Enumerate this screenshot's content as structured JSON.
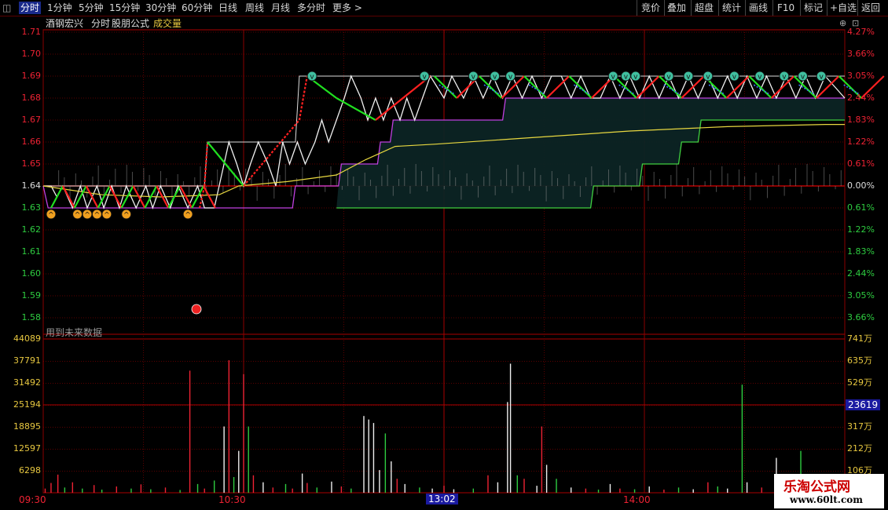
{
  "toolbar": {
    "tabs": [
      "分时",
      "1分钟",
      "5分钟",
      "15分钟",
      "30分钟",
      "60分钟",
      "日线",
      "周线",
      "月线",
      "多分时",
      "更多 >"
    ],
    "right_buttons": [
      "竞价",
      "叠加",
      "超盘",
      "统计",
      "画线",
      "F10",
      "标记",
      "+自选",
      "返回"
    ]
  },
  "header": {
    "stock_name": "酒钢宏兴",
    "mode": "分时",
    "formula": "股朋公式",
    "volume_label": "成交量"
  },
  "price_axis": {
    "left": [
      "1.71",
      "1.70",
      "1.69",
      "1.68",
      "1.67",
      "1.66",
      "1.65",
      "1.64",
      "1.63",
      "1.62",
      "1.61",
      "1.60",
      "1.59",
      "1.58"
    ],
    "right": [
      "4.27%",
      "3.66%",
      "3.05%",
      "2.44%",
      "1.83%",
      "1.22%",
      "0.61%",
      "0.00%",
      "0.61%",
      "1.22%",
      "1.83%",
      "2.44%",
      "3.05%",
      "3.66%"
    ]
  },
  "volume_axis": {
    "left": [
      "44089",
      "37791",
      "31492",
      "25194",
      "18895",
      "12597",
      "6298"
    ],
    "right": [
      "741万",
      "635万",
      "529万",
      "423万",
      "317万",
      "212万",
      "106万"
    ],
    "cursor_value": "23619"
  },
  "time_axis": {
    "labels": [
      "09:30",
      "10:30",
      "14:00"
    ],
    "cursor_time": "13:02"
  },
  "notes": {
    "future_data": "用到未来数据"
  },
  "watermark": {
    "title": "乐淘公式网",
    "url": "www.60lt.com"
  },
  "colors": {
    "up": "#e8202a",
    "down": "#2ecc40",
    "grid": "#7a0000",
    "accent_yellow": "#e8c840"
  },
  "chart_data": {
    "type": "line",
    "price_range": [
      1.58,
      1.71
    ],
    "prev_close": 1.64,
    "price": [
      [
        0,
        1.64
      ],
      [
        8,
        1.64
      ],
      [
        14,
        1.635
      ],
      [
        20,
        1.64
      ],
      [
        30,
        1.63
      ],
      [
        38,
        1.64
      ],
      [
        45,
        1.63
      ],
      [
        55,
        1.64
      ],
      [
        62,
        1.63
      ],
      [
        70,
        1.64
      ],
      [
        78,
        1.63
      ],
      [
        85,
        1.64
      ],
      [
        95,
        1.63
      ],
      [
        105,
        1.64
      ],
      [
        112,
        1.63
      ],
      [
        120,
        1.64
      ],
      [
        130,
        1.63
      ],
      [
        138,
        1.64
      ],
      [
        148,
        1.63
      ],
      [
        158,
        1.64
      ],
      [
        165,
        1.63
      ],
      [
        175,
        1.63
      ],
      [
        180,
        1.64
      ],
      [
        190,
        1.66
      ],
      [
        198,
        1.65
      ],
      [
        205,
        1.64
      ],
      [
        212,
        1.65
      ],
      [
        220,
        1.66
      ],
      [
        230,
        1.65
      ],
      [
        238,
        1.64
      ],
      [
        245,
        1.66
      ],
      [
        252,
        1.65
      ],
      [
        260,
        1.66
      ],
      [
        268,
        1.65
      ],
      [
        278,
        1.66
      ],
      [
        285,
        1.67
      ],
      [
        292,
        1.66
      ],
      [
        300,
        1.67
      ],
      [
        308,
        1.68
      ],
      [
        315,
        1.69
      ],
      [
        325,
        1.68
      ],
      [
        332,
        1.67
      ],
      [
        340,
        1.68
      ],
      [
        348,
        1.67
      ],
      [
        356,
        1.68
      ],
      [
        365,
        1.67
      ],
      [
        372,
        1.68
      ],
      [
        380,
        1.67
      ],
      [
        388,
        1.68
      ],
      [
        396,
        1.69
      ],
      [
        410,
        1.68
      ],
      [
        418,
        1.69
      ],
      [
        430,
        1.68
      ],
      [
        440,
        1.69
      ],
      [
        450,
        1.68
      ],
      [
        460,
        1.69
      ],
      [
        470,
        1.68
      ],
      [
        480,
        1.69
      ],
      [
        490,
        1.68
      ],
      [
        500,
        1.69
      ],
      [
        510,
        1.68
      ],
      [
        520,
        1.69
      ],
      [
        530,
        1.69
      ],
      [
        540,
        1.68
      ],
      [
        550,
        1.69
      ],
      [
        560,
        1.68
      ],
      [
        570,
        1.68
      ],
      [
        580,
        1.69
      ],
      [
        590,
        1.68
      ],
      [
        600,
        1.69
      ],
      [
        610,
        1.68
      ],
      [
        620,
        1.69
      ],
      [
        630,
        1.68
      ],
      [
        640,
        1.69
      ],
      [
        650,
        1.68
      ],
      [
        660,
        1.69
      ],
      [
        670,
        1.68
      ],
      [
        680,
        1.69
      ],
      [
        690,
        1.68
      ],
      [
        700,
        1.69
      ],
      [
        710,
        1.68
      ],
      [
        720,
        1.69
      ],
      [
        730,
        1.68
      ],
      [
        740,
        1.69
      ],
      [
        750,
        1.68
      ],
      [
        760,
        1.69
      ],
      [
        770,
        1.68
      ],
      [
        780,
        1.69
      ],
      [
        790,
        1.68
      ],
      [
        800,
        1.69
      ],
      [
        810,
        1.685
      ],
      [
        820,
        1.68
      ]
    ],
    "avg_price": [
      [
        0,
        1.64
      ],
      [
        60,
        1.636
      ],
      [
        120,
        1.635
      ],
      [
        180,
        1.636
      ],
      [
        200,
        1.64
      ],
      [
        250,
        1.642
      ],
      [
        300,
        1.645
      ],
      [
        330,
        1.652
      ],
      [
        360,
        1.658
      ],
      [
        400,
        1.659
      ],
      [
        500,
        1.662
      ],
      [
        600,
        1.665
      ],
      [
        700,
        1.667
      ],
      [
        800,
        1.668
      ],
      [
        820,
        1.668
      ]
    ],
    "volume_max": 44089,
    "volume": [
      [
        2,
        1200,
        "u"
      ],
      [
        8,
        2800,
        "u"
      ],
      [
        15,
        5200,
        "u"
      ],
      [
        22,
        1500,
        "d"
      ],
      [
        30,
        3000,
        "u"
      ],
      [
        40,
        1200,
        "d"
      ],
      [
        52,
        2200,
        "u"
      ],
      [
        60,
        900,
        "d"
      ],
      [
        75,
        1800,
        "u"
      ],
      [
        90,
        1200,
        "d"
      ],
      [
        100,
        2400,
        "u"
      ],
      [
        110,
        1000,
        "d"
      ],
      [
        125,
        1500,
        "u"
      ],
      [
        140,
        800,
        "d"
      ],
      [
        150,
        35000,
        "u"
      ],
      [
        158,
        2500,
        "d"
      ],
      [
        165,
        1200,
        "u"
      ],
      [
        175,
        3500,
        "d"
      ],
      [
        185,
        19000,
        "w"
      ],
      [
        190,
        38000,
        "u"
      ],
      [
        195,
        4500,
        "d"
      ],
      [
        200,
        12000,
        "w"
      ],
      [
        205,
        34000,
        "u"
      ],
      [
        210,
        19000,
        "d"
      ],
      [
        215,
        5000,
        "u"
      ],
      [
        225,
        3000,
        "w"
      ],
      [
        235,
        1500,
        "u"
      ],
      [
        248,
        2500,
        "d"
      ],
      [
        255,
        1200,
        "u"
      ],
      [
        265,
        5500,
        "w"
      ],
      [
        270,
        2800,
        "u"
      ],
      [
        280,
        1500,
        "d"
      ],
      [
        295,
        3200,
        "w"
      ],
      [
        305,
        1800,
        "u"
      ],
      [
        315,
        1200,
        "d"
      ],
      [
        328,
        22000,
        "w"
      ],
      [
        333,
        21000,
        "w"
      ],
      [
        338,
        20000,
        "w"
      ],
      [
        344,
        6500,
        "w"
      ],
      [
        350,
        17000,
        "d"
      ],
      [
        356,
        9000,
        "w"
      ],
      [
        362,
        4000,
        "u"
      ],
      [
        370,
        2500,
        "w"
      ],
      [
        385,
        1500,
        "d"
      ],
      [
        398,
        1200,
        "w"
      ],
      [
        410,
        2000,
        "u"
      ],
      [
        420,
        1000,
        "w"
      ],
      [
        440,
        1200,
        "d"
      ],
      [
        455,
        5000,
        "u"
      ],
      [
        465,
        3000,
        "w"
      ],
      [
        475,
        26000,
        "w"
      ],
      [
        478,
        37000,
        "w"
      ],
      [
        485,
        5000,
        "d"
      ],
      [
        492,
        4000,
        "u"
      ],
      [
        505,
        2000,
        "w"
      ],
      [
        510,
        19000,
        "u"
      ],
      [
        515,
        8000,
        "w"
      ],
      [
        525,
        4000,
        "d"
      ],
      [
        540,
        1500,
        "w"
      ],
      [
        555,
        1200,
        "u"
      ],
      [
        568,
        900,
        "d"
      ],
      [
        580,
        2500,
        "w"
      ],
      [
        590,
        1200,
        "u"
      ],
      [
        605,
        1000,
        "d"
      ],
      [
        620,
        1800,
        "w"
      ],
      [
        635,
        900,
        "u"
      ],
      [
        650,
        1500,
        "d"
      ],
      [
        665,
        1000,
        "w"
      ],
      [
        680,
        3000,
        "u"
      ],
      [
        690,
        1800,
        "d"
      ],
      [
        700,
        1200,
        "w"
      ],
      [
        715,
        31000,
        "d"
      ],
      [
        720,
        3000,
        "w"
      ],
      [
        735,
        1500,
        "u"
      ],
      [
        750,
        10000,
        "w"
      ],
      [
        760,
        4000,
        "u"
      ],
      [
        775,
        12000,
        "d"
      ],
      [
        785,
        1200,
        "w"
      ],
      [
        795,
        2500,
        "u"
      ],
      [
        810,
        900,
        "d"
      ],
      [
        820,
        1500,
        "u"
      ]
    ]
  }
}
